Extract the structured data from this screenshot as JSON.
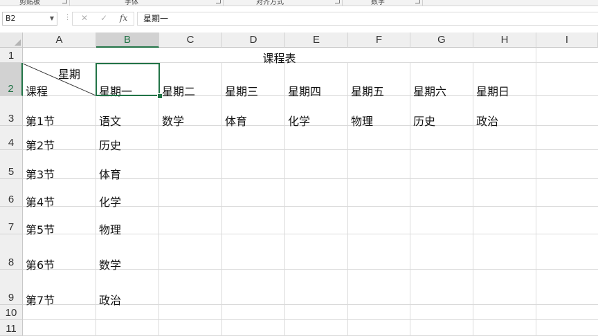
{
  "ribbon": {
    "groups": [
      "剪贴板",
      "字体",
      "对齐方式",
      "数字"
    ]
  },
  "formula_bar": {
    "cell_ref": "B2",
    "cancel_glyph": "✕",
    "confirm_glyph": "✓",
    "fx_label": "fx",
    "content": "星期一"
  },
  "columns": [
    "A",
    "B",
    "C",
    "D",
    "E",
    "F",
    "G",
    "H",
    "I"
  ],
  "rows": [
    "1",
    "2",
    "3",
    "4",
    "5",
    "6",
    "7",
    "8",
    "9",
    "10",
    "11"
  ],
  "selected_cell": {
    "column": "B",
    "row": "2"
  },
  "sheet": {
    "title": "课程表",
    "header_top": "星期",
    "header_bottom": "课程",
    "days": [
      "星期一",
      "星期二",
      "星期三",
      "星期四",
      "星期五",
      "星期六",
      "星期日"
    ],
    "row3_label": "第1节",
    "row3_courses": [
      "语文",
      "数学",
      "体育",
      "化学",
      "物理",
      "历史",
      "政治"
    ],
    "periods": [
      "第2节",
      "第3节",
      "第4节",
      "第5节",
      "第6节",
      "第7节"
    ],
    "monday_courses": [
      "历史",
      "体育",
      "化学",
      "物理",
      "数学",
      "政治"
    ]
  }
}
